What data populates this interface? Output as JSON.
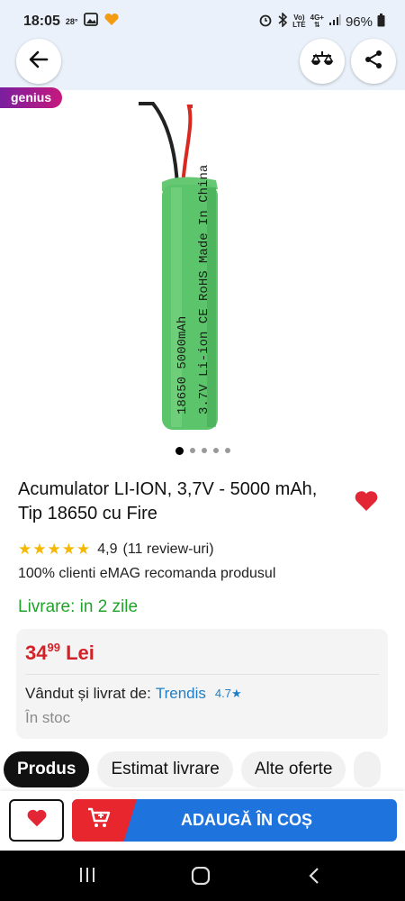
{
  "status_bar": {
    "time": "18:05",
    "temp": "28°",
    "volte_top": "Vo)",
    "volte_bottom": "LTE",
    "network": "4G+",
    "battery": "96%"
  },
  "header": {
    "back_icon": "arrow-left-icon",
    "compare_icon": "compare-scale-icon",
    "share_icon": "share-icon"
  },
  "genius_badge": "genius",
  "product": {
    "title": "Acumulator LI-ION, 3,7V - 5000 mAh, Tip 18650 cu Fire",
    "battery_print_line1": "18650  5000mAh",
    "battery_print_line2": "3.7V Li-ion CE RoHS Made In China",
    "carousel": {
      "count": 5,
      "active": 1
    },
    "rating": "4,9",
    "reviews": "(11 review-uri)",
    "stars": 5,
    "recommend": "100% clienti eMAG recomanda produsul",
    "delivery": "Livrare: in 2 zile"
  },
  "price": {
    "main": "34",
    "cents": "99",
    "currency": "Lei",
    "seller_label": "Vândut și livrat de:",
    "seller": "Trendis",
    "seller_rating": "4.7★",
    "stock": "În stoc"
  },
  "tabs": [
    {
      "label": "Produs"
    },
    {
      "label": "Estimat livrare"
    },
    {
      "label": "Alte oferte"
    }
  ],
  "action": {
    "add_to_cart": "ADAUGĂ ÎN COȘ"
  },
  "colors": {
    "price_red": "#d42027",
    "delivery_green": "#21a32a",
    "link_blue": "#1f7ec5",
    "cart_blue": "#1e73dd",
    "cart_red": "#e8262d",
    "battery_green": "#5cc46a"
  }
}
